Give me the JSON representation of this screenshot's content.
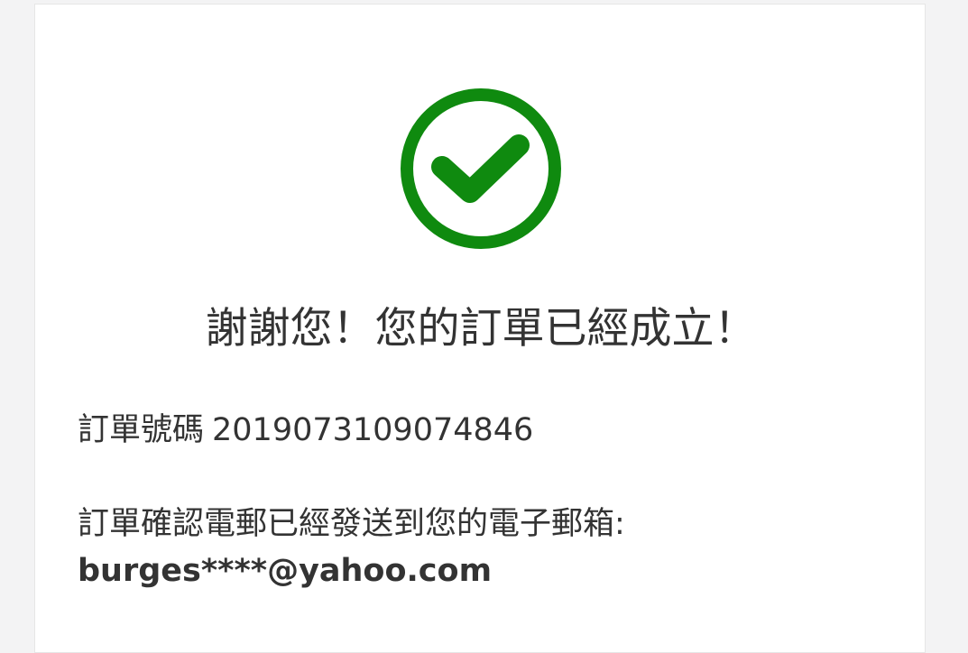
{
  "status": {
    "icon": "check-circle-icon",
    "color": "#0f8a0f"
  },
  "confirmation": {
    "title": "謝謝您！您的訂單已經成立！",
    "order_number_label": "訂單號碼",
    "order_number": "2019073109074846",
    "email_notice": "訂單確認電郵已經發送到您的電子郵箱:",
    "email": "burges****@yahoo.com"
  }
}
